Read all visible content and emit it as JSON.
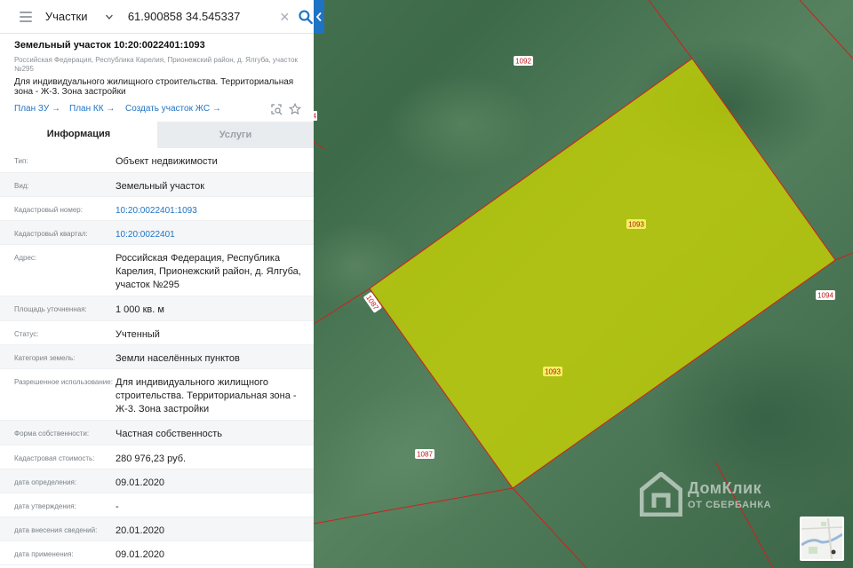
{
  "search": {
    "layer_label": "Участки",
    "query": "61.900858 34.545337"
  },
  "parcel": {
    "title": "Земельный участок 10:20:0022401:1093",
    "address": "Российская Федерация, Республика Карелия, Прионежский район, д. Ялгуба, участок №295",
    "usage": "Для индивидуального жилищного строительства. Территориальная зона - Ж-3. Зона застройки"
  },
  "links": {
    "plan_zu": "План ЗУ →",
    "plan_kk": "План КК →",
    "create_zhs": "Создать участок ЖС →"
  },
  "tabs": {
    "info": "Информация",
    "services": "Услуги"
  },
  "properties": [
    {
      "label": "Тип:",
      "value": "Объект недвижимости"
    },
    {
      "label": "Вид:",
      "value": "Земельный участок"
    },
    {
      "label": "Кадастровый номер:",
      "value": "10:20:0022401:1093"
    },
    {
      "label": "Кадастровый квартал:",
      "value": "10:20:0022401"
    },
    {
      "label": "Адрес:",
      "value": "Российская Федерация, Республика Карелия, Прионежский район, д. Ялгуба, участок №295"
    },
    {
      "label": "Площадь уточненная:",
      "value": "1 000 кв. м"
    },
    {
      "label": "Статус:",
      "value": "Учтенный"
    },
    {
      "label": "Категория земель:",
      "value": "Земли населённых пунктов"
    },
    {
      "label": "Разрешенное использование:",
      "value": "Для индивидуального жилищного строительства. Территориальная зона - Ж-3. Зона застройки"
    },
    {
      "label": "Форма собственности:",
      "value": "Частная собственность"
    },
    {
      "label": "Кадастровая стоимость:",
      "value": "280 976,23 руб."
    },
    {
      "label": "дата определения:",
      "value": "09.01.2020"
    },
    {
      "label": "дата утверждения:",
      "value": "-"
    },
    {
      "label": "дата внесения сведений:",
      "value": "20.01.2020"
    },
    {
      "label": "дата применения:",
      "value": "09.01.2020"
    }
  ],
  "map_labels": {
    "l1092": "1092",
    "l1093a": "1093",
    "l1093b": "1093",
    "l1094": "1094",
    "l1087a": "1087",
    "l1087b": "1087",
    "l4": "4"
  },
  "watermark": {
    "brand": "ДомКлик",
    "sub": "ОТ СБЕРБАНКА"
  },
  "colors": {
    "accent": "#1e73c4",
    "parcel_fill": "#c8d400",
    "boundary": "#d11f1f"
  },
  "icons": [
    "menu-icon",
    "chevron-down-icon",
    "close-icon",
    "search-icon",
    "chevron-left-icon",
    "zoom-to-icon",
    "star-icon",
    "domclick-logo"
  ]
}
